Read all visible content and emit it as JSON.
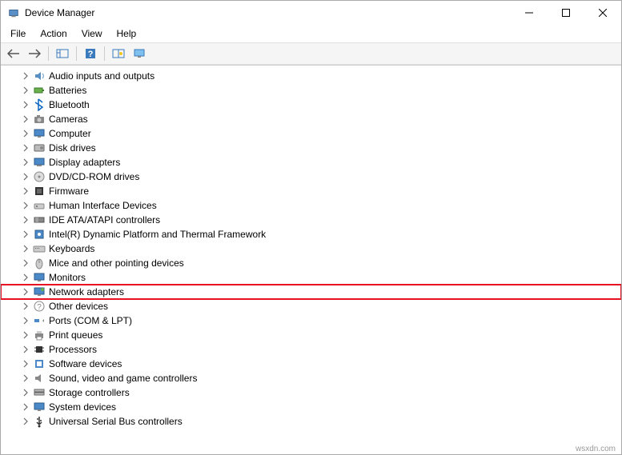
{
  "window": {
    "title": "Device Manager"
  },
  "menubar": {
    "items": [
      "File",
      "Action",
      "View",
      "Help"
    ]
  },
  "tree": {
    "items": [
      {
        "label": "Audio inputs and outputs",
        "icon": "audio"
      },
      {
        "label": "Batteries",
        "icon": "battery"
      },
      {
        "label": "Bluetooth",
        "icon": "bluetooth"
      },
      {
        "label": "Cameras",
        "icon": "camera"
      },
      {
        "label": "Computer",
        "icon": "computer"
      },
      {
        "label": "Disk drives",
        "icon": "disk"
      },
      {
        "label": "Display adapters",
        "icon": "display"
      },
      {
        "label": "DVD/CD-ROM drives",
        "icon": "dvd"
      },
      {
        "label": "Firmware",
        "icon": "firmware"
      },
      {
        "label": "Human Interface Devices",
        "icon": "hid"
      },
      {
        "label": "IDE ATA/ATAPI controllers",
        "icon": "ide"
      },
      {
        "label": "Intel(R) Dynamic Platform and Thermal Framework",
        "icon": "thermal"
      },
      {
        "label": "Keyboards",
        "icon": "keyboard"
      },
      {
        "label": "Mice and other pointing devices",
        "icon": "mouse"
      },
      {
        "label": "Monitors",
        "icon": "monitor"
      },
      {
        "label": "Network adapters",
        "icon": "network",
        "highlighted": true
      },
      {
        "label": "Other devices",
        "icon": "other"
      },
      {
        "label": "Ports (COM & LPT)",
        "icon": "ports"
      },
      {
        "label": "Print queues",
        "icon": "printer"
      },
      {
        "label": "Processors",
        "icon": "cpu"
      },
      {
        "label": "Software devices",
        "icon": "software"
      },
      {
        "label": "Sound, video and game controllers",
        "icon": "sound"
      },
      {
        "label": "Storage controllers",
        "icon": "storage"
      },
      {
        "label": "System devices",
        "icon": "system"
      },
      {
        "label": "Universal Serial Bus controllers",
        "icon": "usb"
      }
    ]
  },
  "footer": {
    "watermark": "wsxdn.com"
  }
}
